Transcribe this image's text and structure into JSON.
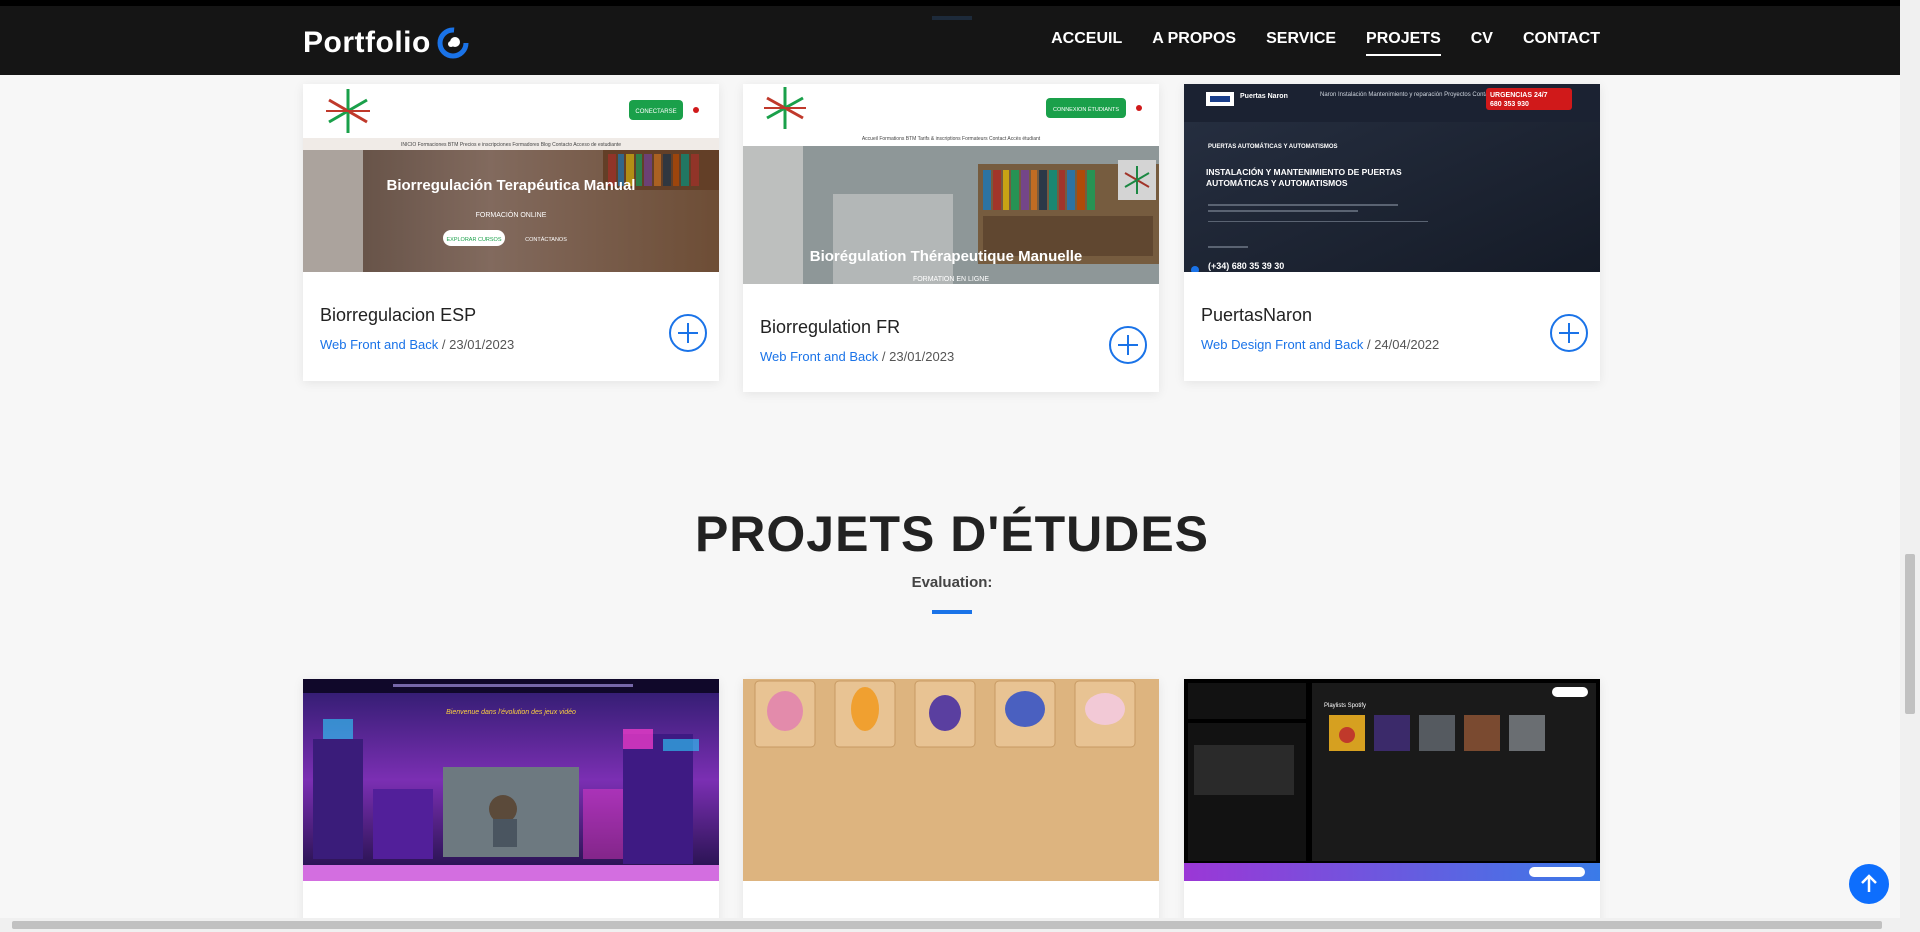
{
  "nav": {
    "brand": "Portfolio",
    "items": [
      {
        "label": "ACCEUIL",
        "active": false
      },
      {
        "label": "A PROPOS",
        "active": false
      },
      {
        "label": "SERVICE",
        "active": false
      },
      {
        "label": "PROJETS",
        "active": true
      },
      {
        "label": "CV",
        "active": false
      },
      {
        "label": "CONTACT",
        "active": false
      }
    ]
  },
  "projects_top": [
    {
      "title": "Biorregulacion ESP",
      "category": "Web Front and Back",
      "date": "23/01/2023",
      "thumb": {
        "heading": "Biorregulación Terapéutica Manual",
        "subheading": "FORMACIÓN ONLINE",
        "cta": "EXPLORAR CURSOS",
        "cta2": "CONTÁCTANOS",
        "top_btn": "CONECTARSE",
        "menu": "INICIO   Formaciones BTM   Precios e inscripciones   Formadores   Blog   Contacto   Acceso de estudiante"
      }
    },
    {
      "title": "Biorregulation FR",
      "category": "Web Front and Back",
      "date": "23/01/2023",
      "thumb": {
        "heading": "Biorégulation Thérapeutique Manuelle",
        "subheading": "FORMATION EN LIGNE",
        "top_btn": "CONNEXION ÉTUDIANTS",
        "menu": "Accueil   Formations BTM   Tarifs & inscriptions   Formateurs   Contact   Accès étudiant"
      }
    },
    {
      "title": "PuertasNaron",
      "category": "Web Design Front and Back",
      "date": "24/04/2022",
      "thumb": {
        "brand": "Puertas Naron",
        "urgent": "URGENCIAS 24/7",
        "urgent_phone": "680 353 930",
        "menu": "Naron   Instalación   Mantenimiento y reparación   Proyectos   Contacto",
        "kicker": "PUERTAS AUTOMÁTICAS Y AUTOMATISMOS",
        "heading": "INSTALACIÓN Y MANTENIMIENTO DE PUERTAS AUTOMÁTICAS Y AUTOMATISMOS",
        "phone": "(+34) 680 35 39 30"
      }
    }
  ],
  "section": {
    "title": "PROJETS D'ÉTUDES",
    "subtitle": "Evaluation:"
  },
  "projects_bottom": [
    {
      "thumb": {
        "heading": "Bienvenue dans l'évolution des jeux vidéo"
      }
    },
    {
      "thumb": {}
    },
    {
      "thumb": {
        "heading": "Playlists Spotify"
      }
    }
  ],
  "colors": {
    "accent": "#1a73e8",
    "navbar": "#151515",
    "bio_green": "#1aa04a",
    "naron_red": "#d0191a"
  }
}
